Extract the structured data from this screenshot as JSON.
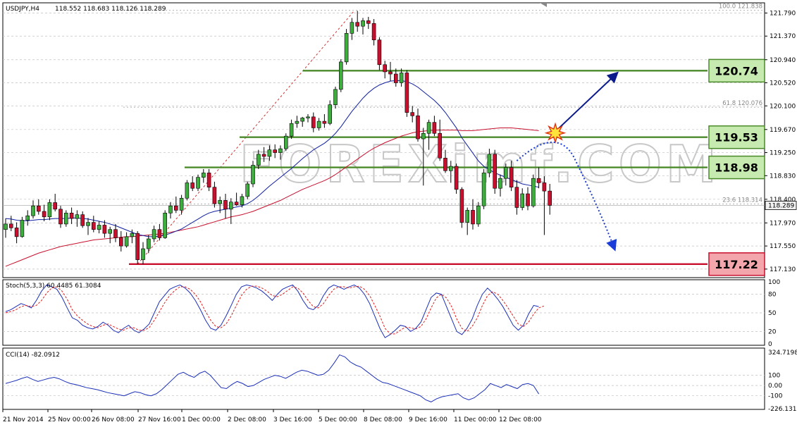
{
  "header": {
    "symbol": "USDJPY,H4",
    "ohlc": "118.552 118.683 118.126 118.289"
  },
  "main_price_labels": [
    "121.790",
    "121.370",
    "120.940",
    "120.520",
    "120.100",
    "119.670",
    "119.250",
    "118.830",
    "118.400",
    "117.970",
    "117.550",
    "117.130"
  ],
  "current_price": "118.289",
  "fib_labels": [
    {
      "text": "100.0  121.838",
      "price": 121.838
    },
    {
      "text": "61.8  120.076",
      "price": 120.076
    },
    {
      "text": "23.6  118.314",
      "price": 118.314
    }
  ],
  "levels": [
    {
      "label": "120.74",
      "price": 120.74,
      "kind": "resistance"
    },
    {
      "label": "119.53",
      "price": 119.53,
      "kind": "resistance"
    },
    {
      "label": "118.98",
      "price": 118.98,
      "kind": "resistance"
    },
    {
      "label": "117.22",
      "price": 117.22,
      "kind": "support"
    }
  ],
  "watermark": "FOREXimf.COM",
  "stoch": {
    "title": "Stoch(5,3,3) 60.4485 61.3084",
    "axis_labels": [
      "100",
      "80",
      "50",
      "20",
      "0"
    ]
  },
  "cci": {
    "title": "CCI(14) -82.0912",
    "axis_labels": [
      "324.7198",
      "100",
      "0.00",
      "-100",
      "-226.1316"
    ]
  },
  "time_labels": [
    "21 Nov 2014",
    "25 Nov 00:00",
    "26 Nov 08:00",
    "27 Nov 16:00",
    "1 Dec 00:00",
    "2 Dec 08:00",
    "3 Dec 16:00",
    "5 Dec 00:00",
    "8 Dec 08:00",
    "9 Dec 16:00",
    "11 Dec 00:00",
    "12 Dec 08:00"
  ],
  "colors": {
    "bull": "#3dae3d",
    "bear": "#c8102e",
    "ma_fast": "#0f1fa0",
    "ma_slow": "#c8102e",
    "resistance_fill": "#c6eab0",
    "resistance_border": "#4b8a2b",
    "support_fill": "#f3a7ad",
    "support_border": "#c8102e",
    "stoch_main": "#1b2fb8",
    "stoch_signal": "#e02020",
    "cci": "#1b2fb8"
  },
  "chart_data": {
    "type": "candlestick",
    "ylim": [
      117.0,
      121.95
    ],
    "candles": [
      [
        117.85,
        118.05,
        117.7,
        117.95
      ],
      [
        117.95,
        118.1,
        117.82,
        117.88
      ],
      [
        117.88,
        117.98,
        117.6,
        117.72
      ],
      [
        117.72,
        118.08,
        117.7,
        118.02
      ],
      [
        118.02,
        118.2,
        117.92,
        118.1
      ],
      [
        118.1,
        118.38,
        118.05,
        118.28
      ],
      [
        118.28,
        118.4,
        118.12,
        118.18
      ],
      [
        118.18,
        118.3,
        118.0,
        118.08
      ],
      [
        118.08,
        118.4,
        118.02,
        118.34
      ],
      [
        118.34,
        118.5,
        118.18,
        118.22
      ],
      [
        118.22,
        118.28,
        117.88,
        117.95
      ],
      [
        117.95,
        118.2,
        117.9,
        118.15
      ],
      [
        118.15,
        118.25,
        117.95,
        118.05
      ],
      [
        118.05,
        118.2,
        117.9,
        118.12
      ],
      [
        118.12,
        118.18,
        117.88,
        117.92
      ],
      [
        117.92,
        118.06,
        117.75,
        117.98
      ],
      [
        117.98,
        118.1,
        117.8,
        117.85
      ],
      [
        117.85,
        118.0,
        117.78,
        117.93
      ],
      [
        117.93,
        118.02,
        117.7,
        117.78
      ],
      [
        117.78,
        117.9,
        117.6,
        117.85
      ],
      [
        117.85,
        117.95,
        117.62,
        117.7
      ],
      [
        117.7,
        117.82,
        117.45,
        117.55
      ],
      [
        117.55,
        117.8,
        117.52,
        117.72
      ],
      [
        117.72,
        117.85,
        117.6,
        117.78
      ],
      [
        117.78,
        117.82,
        117.22,
        117.3
      ],
      [
        117.3,
        117.62,
        117.22,
        117.5
      ],
      [
        117.5,
        117.75,
        117.42,
        117.68
      ],
      [
        117.68,
        117.92,
        117.62,
        117.85
      ],
      [
        117.85,
        117.95,
        117.65,
        117.7
      ],
      [
        117.7,
        118.2,
        117.68,
        118.15
      ],
      [
        118.15,
        118.35,
        118.05,
        118.28
      ],
      [
        118.28,
        118.45,
        118.15,
        118.2
      ],
      [
        118.2,
        118.48,
        118.12,
        118.42
      ],
      [
        118.42,
        118.75,
        118.38,
        118.7
      ],
      [
        118.7,
        118.82,
        118.55,
        118.6
      ],
      [
        118.6,
        118.85,
        118.55,
        118.8
      ],
      [
        118.8,
        118.95,
        118.7,
        118.88
      ],
      [
        118.88,
        118.95,
        118.55,
        118.62
      ],
      [
        118.62,
        118.72,
        118.25,
        118.32
      ],
      [
        118.32,
        118.45,
        118.15,
        118.38
      ],
      [
        118.38,
        118.5,
        118.05,
        118.22
      ],
      [
        118.22,
        118.42,
        117.95,
        118.35
      ],
      [
        118.35,
        118.52,
        118.28,
        118.3
      ],
      [
        118.3,
        118.5,
        118.25,
        118.45
      ],
      [
        118.45,
        118.72,
        118.4,
        118.68
      ],
      [
        118.68,
        119.1,
        118.62,
        119.02
      ],
      [
        119.02,
        119.3,
        118.95,
        119.22
      ],
      [
        119.22,
        119.35,
        119.08,
        119.18
      ],
      [
        119.18,
        119.38,
        119.1,
        119.3
      ],
      [
        119.3,
        119.4,
        119.15,
        119.25
      ],
      [
        119.25,
        119.38,
        119.12,
        119.32
      ],
      [
        119.32,
        119.6,
        119.28,
        119.55
      ],
      [
        119.55,
        119.85,
        119.5,
        119.78
      ],
      [
        119.78,
        119.92,
        119.7,
        119.82
      ],
      [
        119.82,
        119.9,
        119.72,
        119.88
      ],
      [
        119.88,
        119.95,
        119.8,
        119.9
      ],
      [
        119.9,
        119.98,
        119.62,
        119.7
      ],
      [
        119.7,
        119.88,
        119.65,
        119.82
      ],
      [
        119.82,
        119.95,
        119.7,
        119.78
      ],
      [
        119.78,
        120.2,
        119.75,
        120.12
      ],
      [
        120.12,
        120.45,
        120.05,
        120.4
      ],
      [
        120.4,
        120.95,
        120.35,
        120.9
      ],
      [
        120.9,
        121.5,
        120.85,
        121.42
      ],
      [
        121.42,
        121.7,
        121.3,
        121.62
      ],
      [
        121.62,
        121.83,
        121.45,
        121.55
      ],
      [
        121.55,
        121.7,
        121.4,
        121.65
      ],
      [
        121.65,
        121.72,
        121.5,
        121.6
      ],
      [
        121.6,
        121.68,
        121.2,
        121.3
      ],
      [
        121.3,
        121.35,
        120.75,
        120.85
      ],
      [
        120.85,
        120.92,
        120.6,
        120.72
      ],
      [
        120.72,
        120.9,
        120.55,
        120.68
      ],
      [
        120.68,
        120.78,
        120.45,
        120.52
      ],
      [
        120.52,
        120.78,
        120.45,
        120.7
      ],
      [
        120.7,
        120.75,
        119.9,
        119.98
      ],
      [
        119.98,
        120.1,
        119.8,
        119.92
      ],
      [
        119.92,
        120.05,
        119.45,
        119.5
      ],
      [
        119.5,
        119.7,
        118.65,
        119.6
      ],
      [
        119.6,
        119.85,
        119.3,
        119.8
      ],
      [
        119.8,
        119.92,
        119.55,
        119.6
      ],
      [
        119.6,
        119.85,
        119.1,
        119.15
      ],
      [
        119.15,
        119.3,
        118.88,
        118.92
      ],
      [
        118.92,
        119.1,
        118.7,
        119.0
      ],
      [
        119.0,
        119.05,
        118.5,
        118.58
      ],
      [
        118.58,
        118.62,
        117.88,
        117.98
      ],
      [
        117.98,
        118.25,
        117.75,
        118.2
      ],
      [
        118.2,
        118.4,
        117.85,
        117.95
      ],
      [
        117.95,
        118.35,
        117.9,
        118.28
      ],
      [
        118.28,
        118.95,
        118.22,
        118.88
      ],
      [
        118.88,
        119.32,
        118.8,
        119.22
      ],
      [
        119.22,
        119.3,
        118.5,
        118.6
      ],
      [
        118.6,
        118.85,
        118.45,
        118.78
      ],
      [
        118.78,
        119.05,
        118.65,
        118.98
      ],
      [
        118.98,
        119.1,
        118.55,
        118.62
      ],
      [
        118.62,
        118.75,
        118.12,
        118.25
      ],
      [
        118.25,
        118.6,
        118.2,
        118.5
      ],
      [
        118.5,
        118.62,
        118.2,
        118.28
      ],
      [
        118.28,
        118.85,
        118.25,
        118.78
      ],
      [
        118.78,
        118.98,
        118.6,
        118.7
      ],
      [
        118.7,
        118.82,
        117.75,
        118.55
      ],
      [
        118.55,
        118.68,
        118.12,
        118.29
      ]
    ],
    "ma_fast": [
      118.05,
      118.04,
      118.02,
      118.01,
      118.01,
      118.02,
      118.03,
      118.03,
      118.04,
      118.05,
      118.05,
      118.05,
      118.06,
      118.06,
      118.05,
      118.04,
      118.02,
      118.0,
      117.98,
      117.95,
      117.92,
      117.88,
      117.84,
      117.8,
      117.76,
      117.74,
      117.72,
      117.72,
      117.73,
      117.75,
      117.78,
      117.82,
      117.86,
      117.92,
      117.98,
      118.04,
      118.1,
      118.15,
      118.18,
      118.2,
      118.22,
      118.24,
      118.26,
      118.28,
      118.32,
      118.38,
      118.46,
      118.55,
      118.64,
      118.72,
      118.8,
      118.88,
      118.96,
      119.05,
      119.14,
      119.22,
      119.3,
      119.36,
      119.42,
      119.5,
      119.6,
      119.72,
      119.86,
      120.0,
      120.12,
      120.24,
      120.34,
      120.42,
      120.48,
      120.52,
      120.55,
      120.56,
      120.56,
      120.54,
      120.5,
      120.44,
      120.36,
      120.28,
      120.2,
      120.1,
      119.98,
      119.84,
      119.7,
      119.52,
      119.38,
      119.24,
      119.1,
      119.0,
      118.94,
      118.88,
      118.84,
      118.8,
      118.76,
      118.72,
      118.68,
      118.66,
      118.64,
      118.62
    ],
    "ma_slow": [
      117.18,
      117.22,
      117.26,
      117.3,
      117.34,
      117.38,
      117.42,
      117.45,
      117.48,
      117.51,
      117.54,
      117.56,
      117.58,
      117.6,
      117.62,
      117.64,
      117.66,
      117.67,
      117.68,
      117.69,
      117.7,
      117.71,
      117.72,
      117.72,
      117.73,
      117.74,
      117.75,
      117.76,
      117.77,
      117.78,
      117.8,
      117.82,
      117.84,
      117.86,
      117.88,
      117.9,
      117.93,
      117.96,
      117.99,
      118.02,
      118.05,
      118.08,
      118.1,
      118.12,
      118.15,
      118.18,
      118.22,
      118.26,
      118.3,
      118.34,
      118.38,
      118.43,
      118.48,
      118.53,
      118.58,
      118.62,
      118.66,
      118.7,
      118.74,
      118.79,
      118.85,
      118.92,
      118.99,
      119.06,
      119.13,
      119.2,
      119.27,
      119.33,
      119.38,
      119.43,
      119.47,
      119.51,
      119.55,
      119.58,
      119.61,
      119.63,
      119.64,
      119.65,
      119.66,
      119.66,
      119.66,
      119.66,
      119.66,
      119.65,
      119.65,
      119.65,
      119.66,
      119.67,
      119.68,
      119.69,
      119.7,
      119.7,
      119.7,
      119.69,
      119.68,
      119.67,
      119.66,
      119.65
    ],
    "stoch_main": [
      52,
      55,
      60,
      65,
      62,
      58,
      70,
      85,
      95,
      92,
      88,
      75,
      58,
      42,
      38,
      30,
      26,
      24,
      28,
      35,
      30,
      22,
      18,
      25,
      30,
      22,
      18,
      24,
      32,
      50,
      68,
      78,
      88,
      92,
      95,
      90,
      82,
      70,
      55,
      38,
      25,
      22,
      30,
      45,
      62,
      80,
      92,
      95,
      93,
      90,
      85,
      78,
      70,
      80,
      88,
      92,
      95,
      85,
      70,
      58,
      55,
      62,
      78,
      90,
      95,
      92,
      88,
      92,
      95,
      90,
      80,
      65,
      45,
      25,
      10,
      15,
      22,
      30,
      28,
      20,
      25,
      35,
      55,
      75,
      82,
      80,
      60,
      40,
      20,
      15,
      25,
      40,
      62,
      80,
      90,
      82,
      72,
      60,
      45,
      30,
      22,
      30,
      48,
      62,
      60
    ],
    "stoch_signal": [
      50,
      52,
      55,
      60,
      62,
      60,
      62,
      70,
      82,
      90,
      92,
      85,
      72,
      55,
      45,
      38,
      32,
      28,
      26,
      30,
      32,
      28,
      24,
      22,
      26,
      26,
      22,
      22,
      26,
      38,
      52,
      66,
      78,
      86,
      92,
      92,
      88,
      80,
      68,
      52,
      38,
      28,
      26,
      32,
      45,
      62,
      78,
      88,
      93,
      93,
      90,
      85,
      78,
      76,
      80,
      86,
      92,
      90,
      82,
      70,
      60,
      58,
      65,
      78,
      88,
      92,
      92,
      90,
      92,
      93,
      88,
      78,
      62,
      45,
      25,
      16,
      16,
      22,
      27,
      26,
      24,
      28,
      40,
      58,
      74,
      80,
      74,
      60,
      40,
      25,
      20,
      28,
      42,
      62,
      78,
      84,
      80,
      70,
      58,
      45,
      32,
      28,
      35,
      48,
      58,
      61
    ],
    "cci": [
      20,
      35,
      50,
      70,
      85,
      60,
      40,
      55,
      70,
      80,
      65,
      40,
      20,
      10,
      -5,
      -20,
      -30,
      -40,
      -55,
      -70,
      -80,
      -90,
      -100,
      -80,
      -60,
      -70,
      -90,
      -100,
      -80,
      -40,
      10,
      60,
      110,
      130,
      100,
      80,
      120,
      140,
      100,
      40,
      -20,
      -30,
      10,
      40,
      20,
      -10,
      0,
      30,
      60,
      80,
      100,
      90,
      70,
      100,
      130,
      150,
      140,
      120,
      100,
      110,
      150,
      220,
      300,
      280,
      230,
      200,
      180,
      140,
      100,
      60,
      30,
      20,
      0,
      -20,
      -40,
      -60,
      -80,
      -100,
      -140,
      -160,
      -130,
      -110,
      -100,
      -90,
      -80,
      -120,
      -140,
      -120,
      -80,
      -40,
      20,
      0,
      -20,
      10,
      -10,
      -30,
      10,
      20,
      0,
      -82
    ]
  }
}
